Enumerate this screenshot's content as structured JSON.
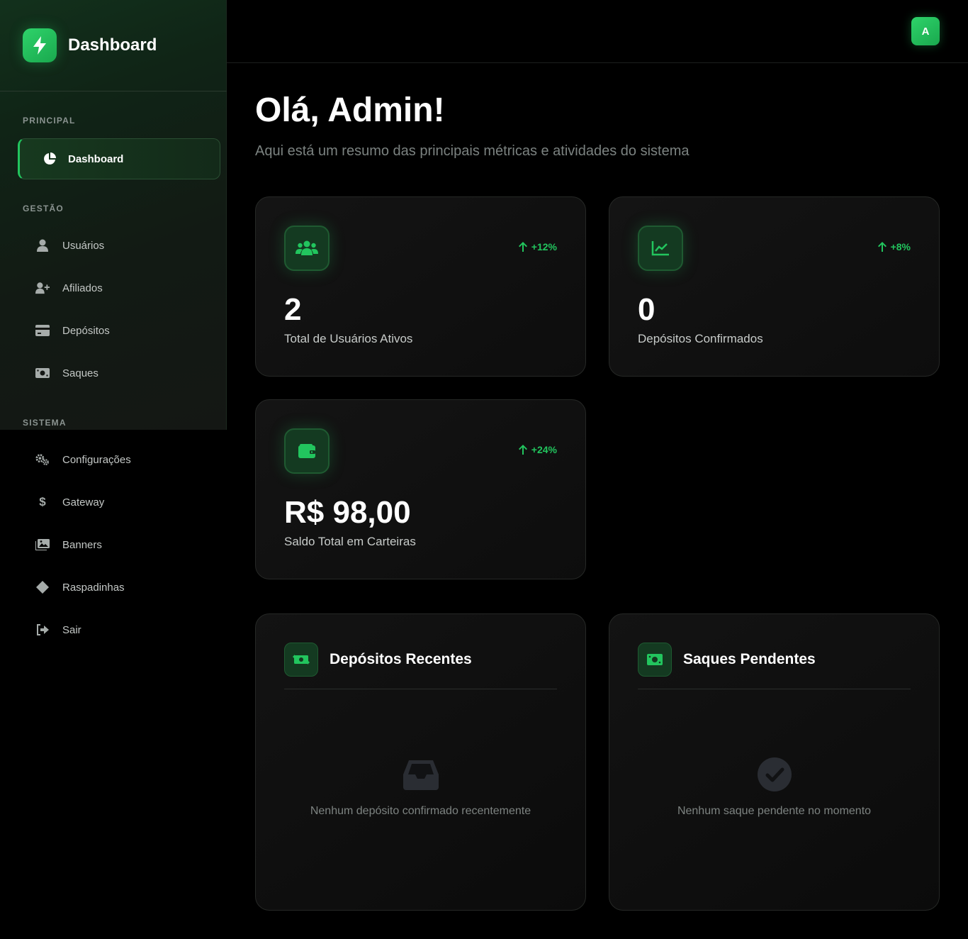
{
  "sidebar": {
    "brand_title": "Dashboard",
    "brand_icon": "bolt-icon",
    "sections": {
      "principal": "PRINCIPAL",
      "gestao": "GESTÃO",
      "sistema": "SISTEMA"
    },
    "items": [
      {
        "label": "Dashboard",
        "icon": "pie-chart-icon",
        "active": true
      },
      {
        "label": "Usuários",
        "icon": "user-icon"
      },
      {
        "label": "Afiliados",
        "icon": "user-plus-icon"
      },
      {
        "label": "Depósitos",
        "icon": "credit-card-icon"
      },
      {
        "label": "Saques",
        "icon": "money-bill-icon"
      },
      {
        "label": "Configurações",
        "icon": "gears-icon"
      },
      {
        "label": "Gateway",
        "icon": "dollar-icon"
      },
      {
        "label": "Banners",
        "icon": "images-icon"
      },
      {
        "label": "Raspadinhas",
        "icon": "diamond-icon"
      },
      {
        "label": "Sair",
        "icon": "logout-icon"
      }
    ]
  },
  "header": {
    "avatar_initial": "A"
  },
  "main": {
    "greeting": "Olá, Admin!",
    "subtitle": "Aqui está um resumo das principais métricas e atividades do sistema",
    "stats": [
      {
        "icon": "users-icon",
        "trend": "+12%",
        "value": "2",
        "label": "Total de Usuários Ativos"
      },
      {
        "icon": "chart-line-icon",
        "trend": "+8%",
        "value": "0",
        "label": "Depósitos Confirmados"
      },
      {
        "icon": "wallet-icon",
        "trend": "+24%",
        "value": "R$ 98,00",
        "label": "Saldo Total em Carteiras"
      }
    ],
    "panels": [
      {
        "icon": "money-bill-transfer-icon",
        "title": "Depósitos Recentes",
        "empty_icon": "inbox-icon",
        "empty_text": "Nenhum depósito confirmado recentemente"
      },
      {
        "icon": "money-bill-icon",
        "title": "Saques Pendentes",
        "empty_icon": "check-circle-icon",
        "empty_text": "Nenhum saque pendente no momento"
      }
    ]
  },
  "colors": {
    "accent": "#22c55e",
    "background": "#000000"
  }
}
